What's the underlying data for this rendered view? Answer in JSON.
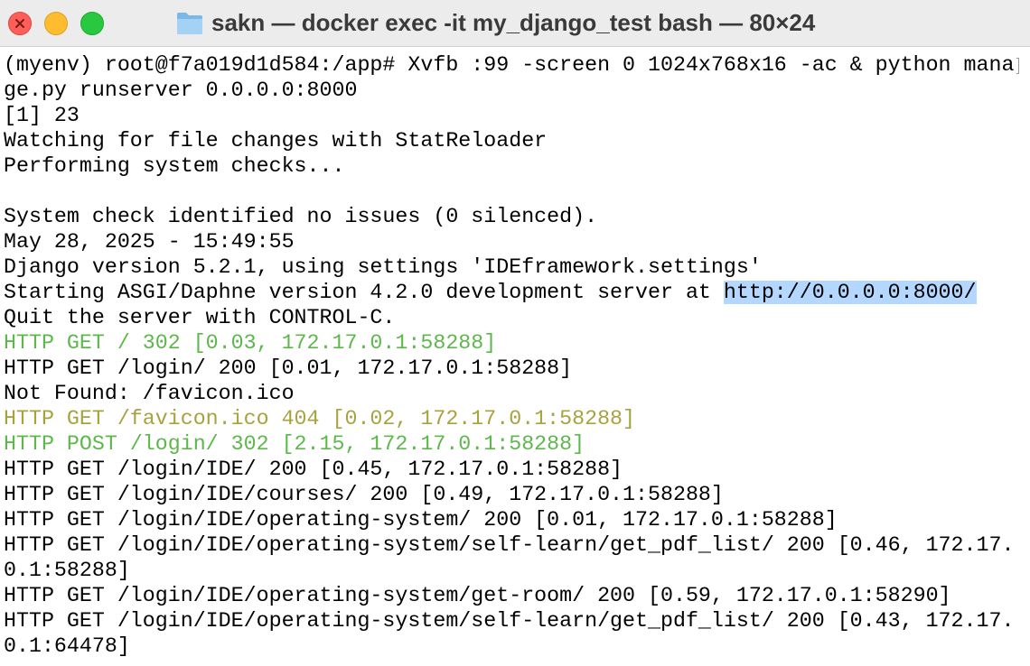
{
  "window": {
    "title": "sakn — docker exec -it my_django_test bash — 80×24",
    "folder_icon": "folder-icon"
  },
  "colors": {
    "success": "#5cb84a",
    "warning": "#a8a23e",
    "selection": "#b3d7ff"
  },
  "terminal": {
    "lines": [
      {
        "text": "(myenv) root@f7a019d1d584:/app# Xvfb :99 -screen 0 1024x768x16 -ac & python mana",
        "color": "default"
      },
      {
        "text": "ge.py runserver 0.0.0.0:8000",
        "color": "default"
      },
      {
        "text": "[1] 23",
        "color": "default"
      },
      {
        "text": "Watching for file changes with StatReloader",
        "color": "default"
      },
      {
        "text": "Performing system checks...",
        "color": "default"
      },
      {
        "text": "",
        "color": "default"
      },
      {
        "text": "System check identified no issues (0 silenced).",
        "color": "default"
      },
      {
        "text": "May 28, 2025 - 15:49:55",
        "color": "default"
      },
      {
        "text": "Django version 5.2.1, using settings 'IDEframework.settings'",
        "color": "default"
      },
      {
        "text": "Starting ASGI/Daphne version 4.2.0 development server at ",
        "color": "default",
        "link": "http://0.0.0.0:8000/"
      },
      {
        "text": "Quit the server with CONTROL-C.",
        "color": "default"
      },
      {
        "text": "HTTP GET / 302 [0.03, 172.17.0.1:58288]",
        "color": "green"
      },
      {
        "text": "HTTP GET /login/ 200 [0.01, 172.17.0.1:58288]",
        "color": "default"
      },
      {
        "text": "Not Found: /favicon.ico",
        "color": "default"
      },
      {
        "text": "HTTP GET /favicon.ico 404 [0.02, 172.17.0.1:58288]",
        "color": "olive"
      },
      {
        "text": "HTTP POST /login/ 302 [2.15, 172.17.0.1:58288]",
        "color": "green"
      },
      {
        "text": "HTTP GET /login/IDE/ 200 [0.45, 172.17.0.1:58288]",
        "color": "default"
      },
      {
        "text": "HTTP GET /login/IDE/courses/ 200 [0.49, 172.17.0.1:58288]",
        "color": "default"
      },
      {
        "text": "HTTP GET /login/IDE/operating-system/ 200 [0.01, 172.17.0.1:58288]",
        "color": "default"
      },
      {
        "text": "HTTP GET /login/IDE/operating-system/self-learn/get_pdf_list/ 200 [0.46, 172.17.",
        "color": "default"
      },
      {
        "text": "0.1:58288]",
        "color": "default"
      },
      {
        "text": "HTTP GET /login/IDE/operating-system/get-room/ 200 [0.59, 172.17.0.1:58290]",
        "color": "default"
      },
      {
        "text": "HTTP GET /login/IDE/operating-system/self-learn/get_pdf_list/ 200 [0.43, 172.17.",
        "color": "default"
      },
      {
        "text": "0.1:64478]",
        "color": "default"
      }
    ]
  }
}
